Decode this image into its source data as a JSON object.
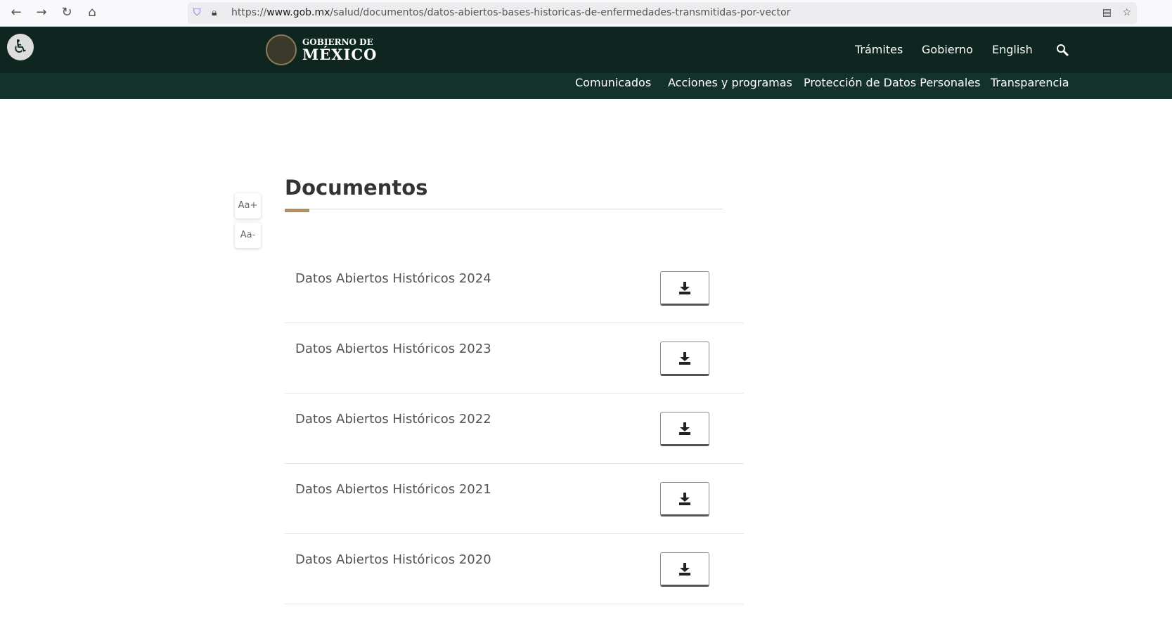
{
  "browser": {
    "url_prefix": "https://",
    "url_host": "www.gob.mx",
    "url_path": "/salud/documentos/datos-abiertos-bases-historicas-de-enfermedades-transmitidas-por-vector"
  },
  "header": {
    "logo_line1": "GOBIERNO DE",
    "logo_line2": "MÉXICO",
    "nav": [
      "Trámites",
      "Gobierno",
      "English"
    ],
    "subnav": [
      "Comunicados",
      "Acciones y programas",
      "Protección de Datos Personales",
      "Transparencia"
    ]
  },
  "font_controls": {
    "increase": "Aa+",
    "decrease": "Aa-"
  },
  "main": {
    "title": "Documentos",
    "accent_color": "#b38e5d",
    "documents": [
      {
        "label": "Datos Abiertos Históricos 2024"
      },
      {
        "label": "Datos Abiertos Históricos 2023"
      },
      {
        "label": "Datos Abiertos Históricos 2022"
      },
      {
        "label": "Datos Abiertos Históricos 2021"
      },
      {
        "label": "Datos Abiertos Históricos 2020"
      }
    ]
  }
}
